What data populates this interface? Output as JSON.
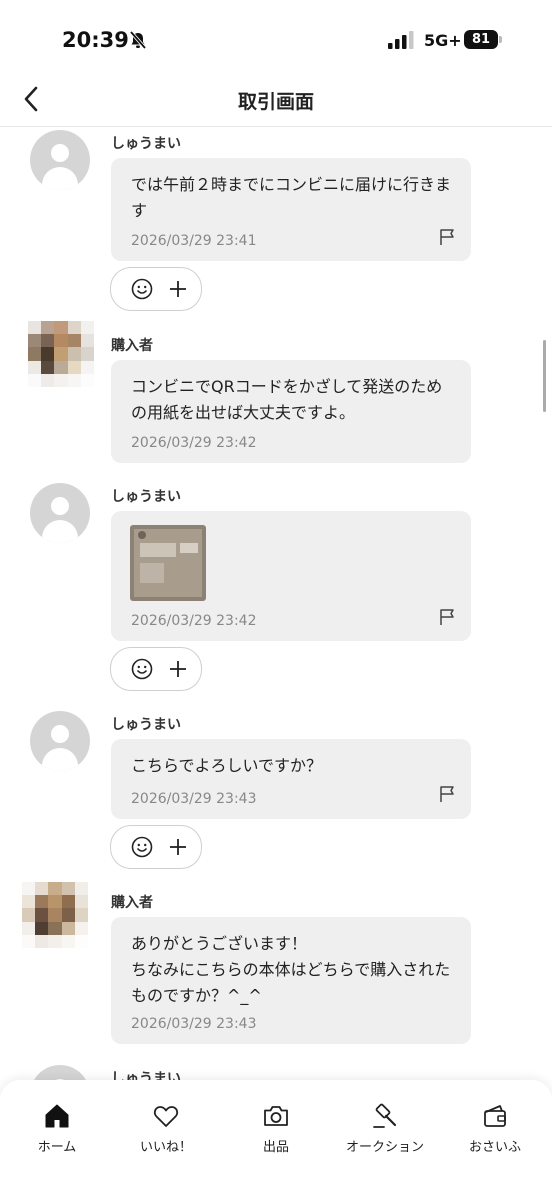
{
  "status": {
    "time": "20:39",
    "network": "5G+",
    "battery": "81"
  },
  "header": {
    "title": "取引画面"
  },
  "messages": [
    {
      "sender": "しゅうまい",
      "text": "では午前２時までにコンビニに届けに行きます",
      "time": "2026/03/29 23:41"
    },
    {
      "sender": "購入者",
      "text": "コンビニでQRコードをかざして発送のための用紙を出せば大丈夫ですよ。",
      "time": "2026/03/29 23:42"
    },
    {
      "sender": "しゅうまい",
      "text": "",
      "time": "2026/03/29 23:42"
    },
    {
      "sender": "しゅうまい",
      "text": "こちらでよろしいですか？",
      "time": "2026/03/29 23:43"
    },
    {
      "sender": "購入者",
      "text": "ありがとうございます！\nちなみにこちらの本体はどちらで購入されたものですか？^_^",
      "time": "2026/03/29 23:43"
    },
    {
      "sender": "しゅうまい"
    }
  ],
  "tabs": [
    {
      "label": "ホーム",
      "icon": "home-icon"
    },
    {
      "label": "いいね！",
      "icon": "heart-icon"
    },
    {
      "label": "出品",
      "icon": "camera-icon"
    },
    {
      "label": "オークション",
      "icon": "gavel-icon"
    },
    {
      "label": "おさいふ",
      "icon": "wallet-icon"
    }
  ]
}
